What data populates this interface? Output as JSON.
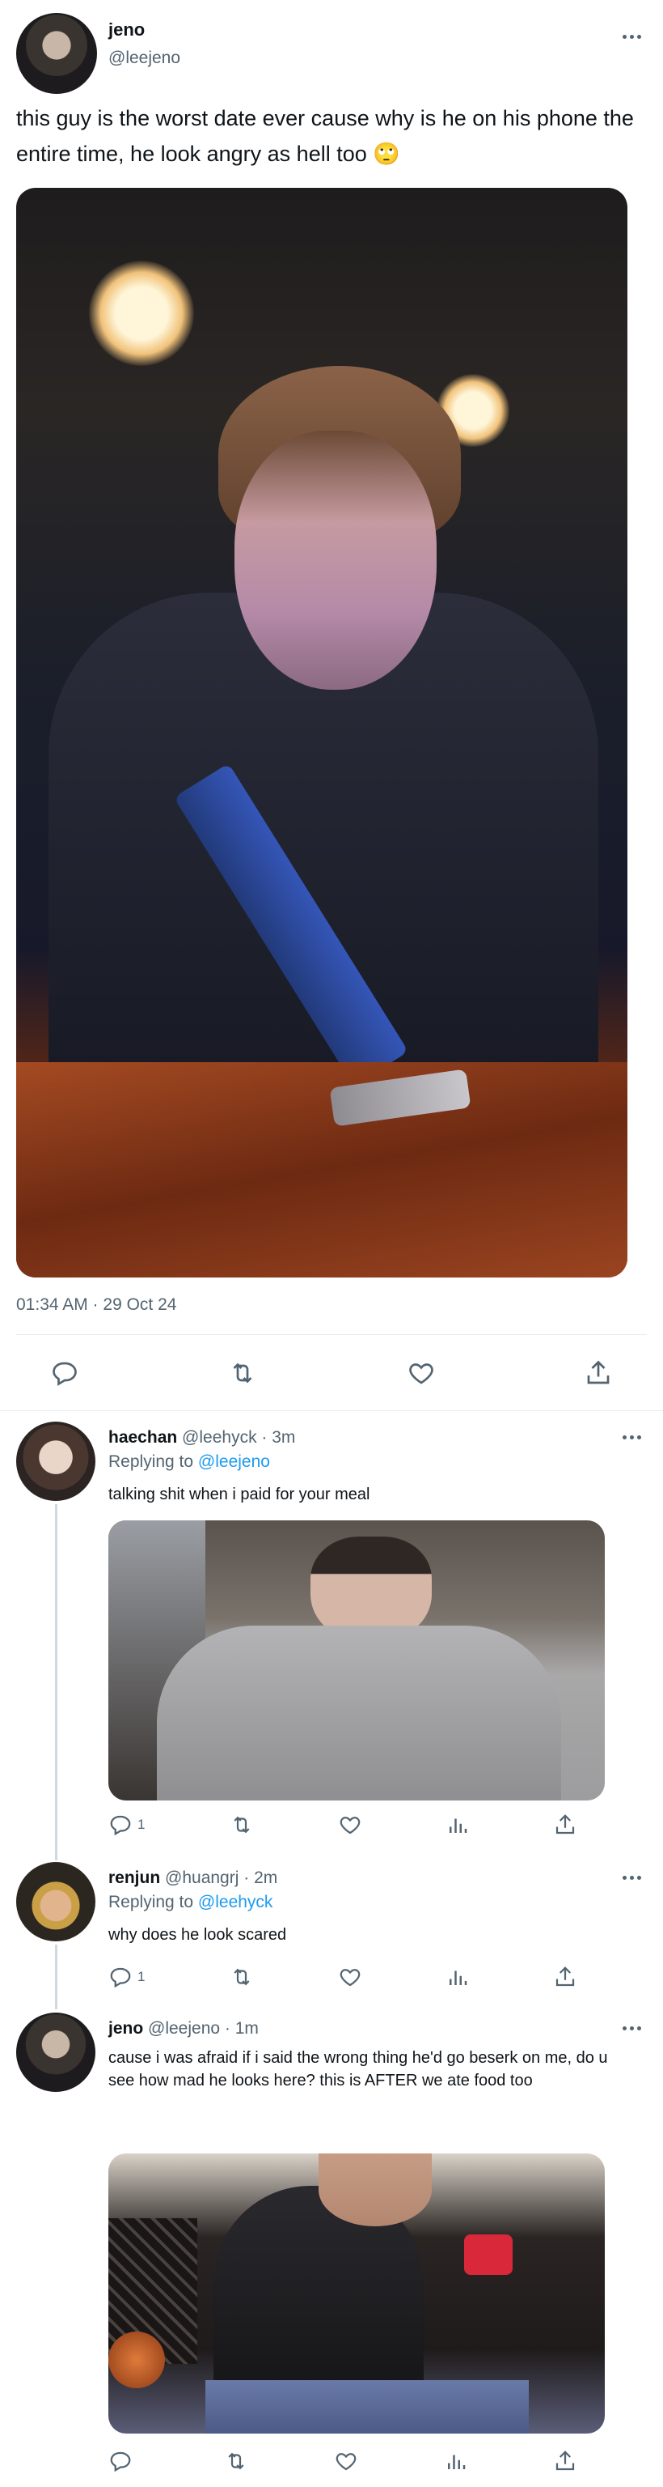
{
  "main_tweet": {
    "display_name": "jeno",
    "handle": "@leejeno",
    "text": "this guy is the worst date ever cause why is he on his phone the entire time, he look angry as hell too 🙄",
    "timestamp": "01:34 AM · 29 Oct 24",
    "actions": [
      "reply-icon",
      "retweet-icon",
      "like-icon",
      "share-icon"
    ]
  },
  "replies": [
    {
      "display_name": "haechan",
      "handle": "@leehyck",
      "time": "3m",
      "replying_to_label": "Replying to",
      "replying_to_handle": "@leejeno",
      "text": "talking shit when i paid for your meal",
      "reply_count": "1",
      "has_photo": true
    },
    {
      "display_name": "renjun",
      "handle": "@huangrj",
      "time": "2m",
      "replying_to_label": "Replying to",
      "replying_to_handle": "@leehyck",
      "text": "why does he look scared",
      "reply_count": "1",
      "has_photo": false
    },
    {
      "display_name": "jeno",
      "handle": "@leejeno",
      "time": "1m",
      "replying_to_label": "",
      "replying_to_handle": "",
      "text": "cause i was afraid if i said the wrong thing he'd go beserk on me, do u see how mad he looks here? this is AFTER we ate food too",
      "reply_count": "",
      "has_photo": true
    }
  ],
  "colors": {
    "text_primary": "#0f1419",
    "text_secondary": "#536471",
    "link": "#1d9bf0",
    "divider": "#e6ecf0",
    "thread_line": "#cfd9de"
  }
}
